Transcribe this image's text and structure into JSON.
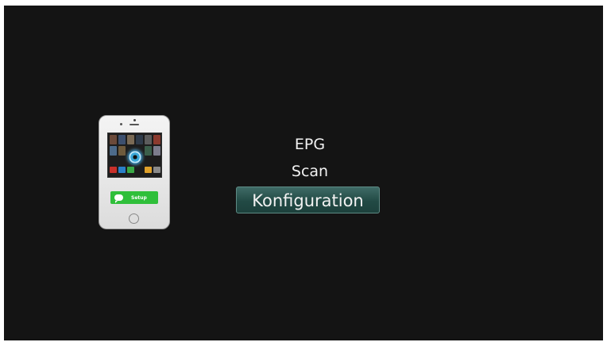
{
  "illustration": {
    "setup_label": "Setup",
    "icon": "chat-bubble-icon",
    "accent": "#2fbf3a"
  },
  "menu": {
    "items": [
      {
        "label": "EPG"
      },
      {
        "label": "Scan"
      },
      {
        "label": "Konfiguration"
      }
    ],
    "selected_index": 2,
    "highlight_color": "#2e5a55"
  }
}
